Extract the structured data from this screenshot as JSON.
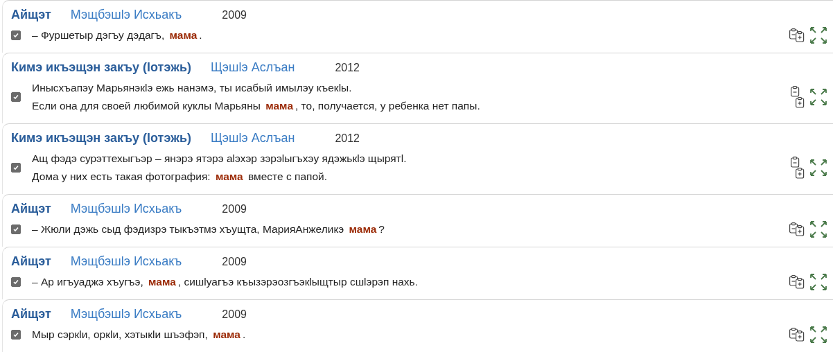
{
  "results": [
    {
      "title": "Айщэт",
      "author": "Мэщбэшlэ Исхьакъ",
      "year": "2009",
      "checked": true,
      "lines": [
        "– Фуршетыр дэгъу дэдагъ, **мама**."
      ]
    },
    {
      "title": "Кимэ икъэщэн закъу (lотэжь)",
      "author": "Щэшlэ Аслъан",
      "year": "2012",
      "checked": true,
      "lines": [
        "Инысхъапэу Марьянэкlэ ежь нанэмэ, ты исабый имылэу къекlы.",
        "Если она для своей любимой куклы Марьяны **мама**, то, получается, у ребенка нет папы."
      ]
    },
    {
      "title": "Кимэ икъэщэн закъу (lотэжь)",
      "author": "Щэшlэ Аслъан",
      "year": "2012",
      "checked": true,
      "lines": [
        "Ащ фэдэ сурэттехыгъэр – янэрэ ятэрэ аlэхэр зэрэlыгъхэу ядэжькlэ щырятl.",
        "Дома у них есть такая фотография: **мама** вместе с папой."
      ]
    },
    {
      "title": "Айщэт",
      "author": "Мэщбэшlэ Исхьакъ",
      "year": "2009",
      "checked": true,
      "lines": [
        "– Жюли дэжь сыд фэдизрэ тыкъэтмэ хъущта, МарияАнжеликэ **мама**?"
      ]
    },
    {
      "title": "Айщэт",
      "author": "Мэщбэшlэ Исхьакъ",
      "year": "2009",
      "checked": true,
      "lines": [
        "– Ар игъуаджэ хъугъэ, **мама**, сишlуагъэ къызэрэозгъэкlыщтыр сшlэрэп нахь."
      ]
    },
    {
      "title": "Айщэт",
      "author": "Мэщбэшlэ Исхьакъ",
      "year": "2009",
      "checked": true,
      "lines": [
        "Мыр сэркlи, оркlи, хэтыкlи шъэфэп, **мама**."
      ]
    }
  ]
}
